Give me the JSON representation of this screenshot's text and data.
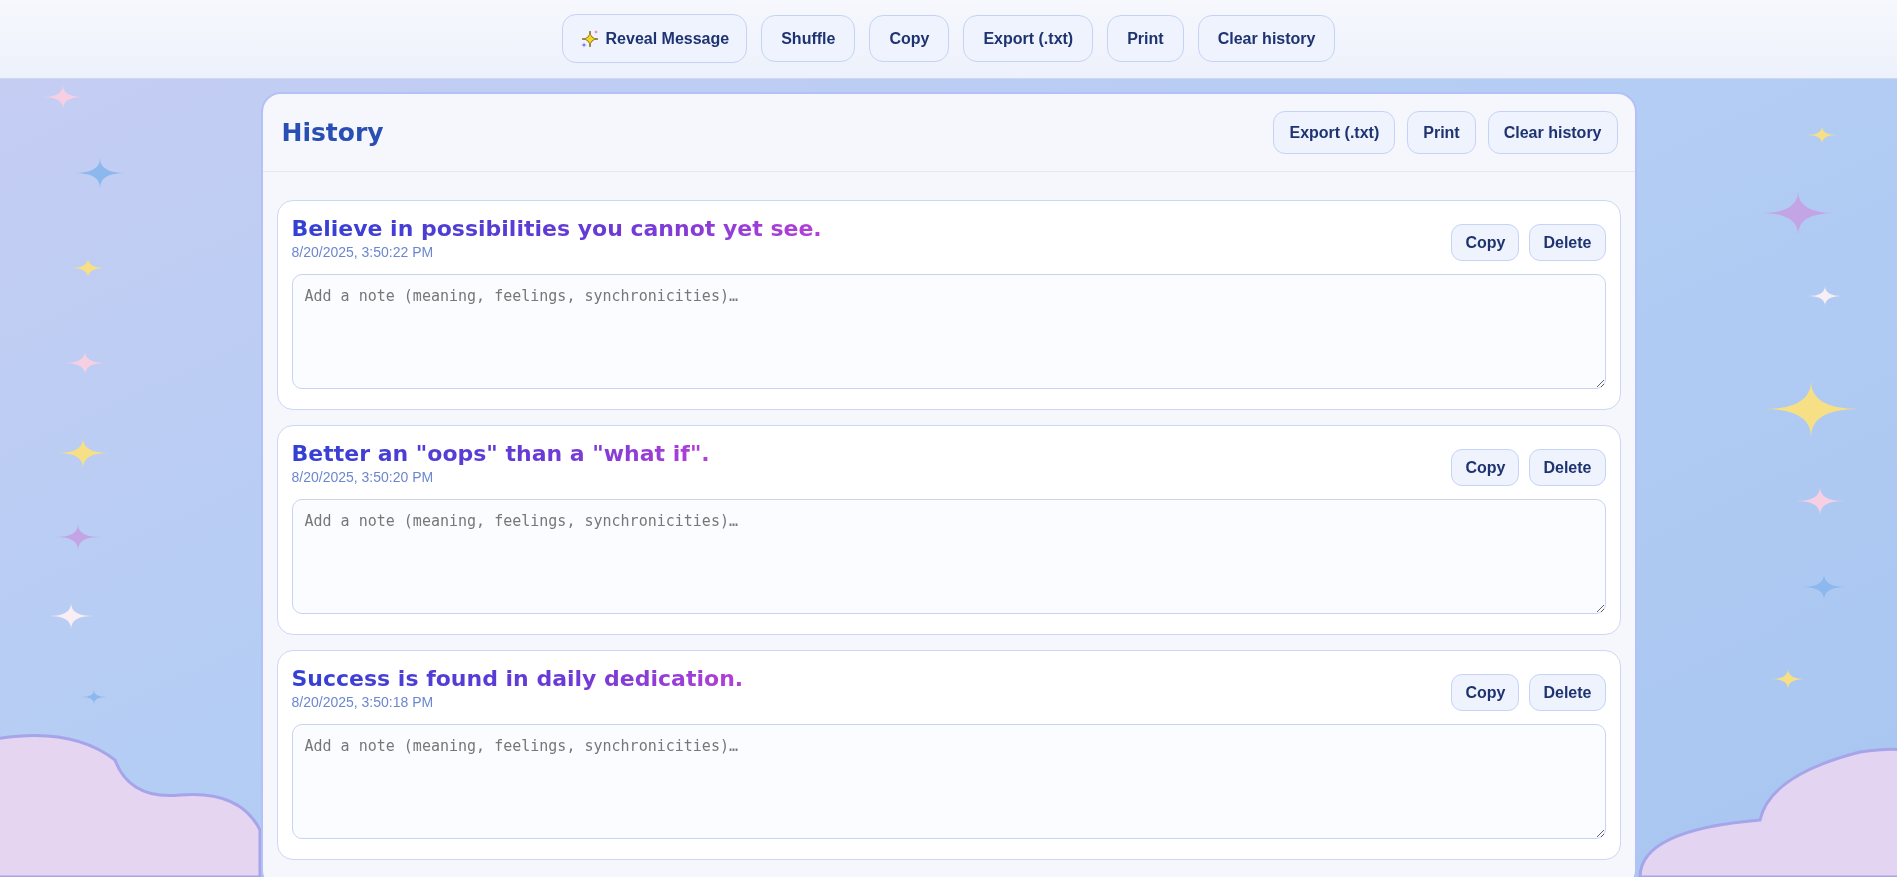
{
  "toolbar": {
    "buttons": [
      {
        "label": "Reveal Message",
        "kind": "reveal"
      },
      {
        "label": "Shuffle",
        "kind": "plain"
      },
      {
        "label": "Copy",
        "kind": "plain"
      },
      {
        "label": "Export (.txt)",
        "kind": "plain"
      },
      {
        "label": "Print",
        "kind": "plain"
      },
      {
        "label": "Clear history",
        "kind": "plain"
      }
    ]
  },
  "history": {
    "title": "History",
    "buttons": [
      "Export (.txt)",
      "Print",
      "Clear history"
    ],
    "entries": [
      {
        "message": "Believe in possibilities you cannot yet see.",
        "timestamp": "8/20/2025, 3:50:22 PM",
        "note_placeholder": "Add a note (meaning, feelings, synchronicities)…",
        "buttons": [
          "Copy",
          "Delete"
        ]
      },
      {
        "message": "Better an \"oops\" than a \"what if\".",
        "timestamp": "8/20/2025, 3:50:20 PM",
        "note_placeholder": "Add a note (meaning, feelings, synchronicities)…",
        "buttons": [
          "Copy",
          "Delete"
        ]
      },
      {
        "message": "Success is found in daily dedication.",
        "timestamp": "8/20/2025, 3:50:18 PM",
        "note_placeholder": "Add a note (meaning, feelings, synchronicities)…",
        "buttons": [
          "Copy",
          "Delete"
        ]
      }
    ]
  }
}
